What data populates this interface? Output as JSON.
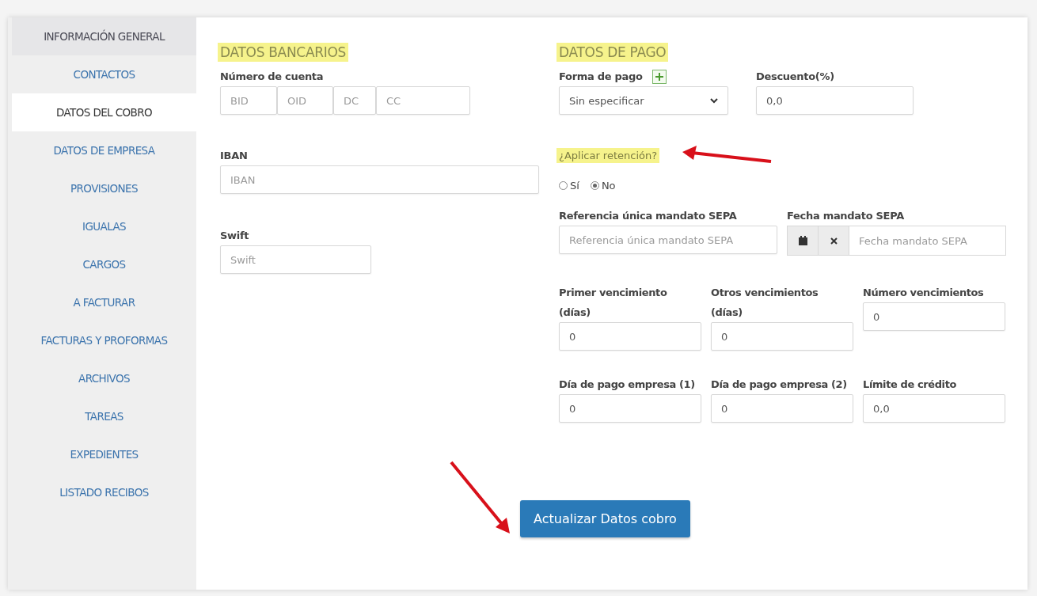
{
  "sidebar": {
    "items": [
      {
        "label": "INFORMACIÓN GENERAL",
        "selected": false
      },
      {
        "label": "CONTACTOS",
        "selected": false
      },
      {
        "label": "DATOS DEL COBRO",
        "selected": true
      },
      {
        "label": "DATOS DE EMPRESA",
        "selected": false
      },
      {
        "label": "PROVISIONES",
        "selected": false
      },
      {
        "label": "IGUALAS",
        "selected": false
      },
      {
        "label": "CARGOS",
        "selected": false
      },
      {
        "label": "A FACTURAR",
        "selected": false
      },
      {
        "label": "FACTURAS Y PROFORMAS",
        "selected": false
      },
      {
        "label": "ARCHIVOS",
        "selected": false
      },
      {
        "label": "TAREAS",
        "selected": false
      },
      {
        "label": "EXPEDIENTES",
        "selected": false
      },
      {
        "label": "LISTADO RECIBOS",
        "selected": false
      }
    ]
  },
  "bank": {
    "title": "DATOS BANCARIOS",
    "account_label": "Número de cuenta",
    "account_parts": [
      {
        "placeholder": "BID"
      },
      {
        "placeholder": "OID"
      },
      {
        "placeholder": "DC"
      },
      {
        "placeholder": "CC"
      }
    ],
    "iban_label": "IBAN",
    "iban_placeholder": "IBAN",
    "swift_label": "Swift",
    "swift_placeholder": "Swift"
  },
  "payment": {
    "title": "DATOS DE PAGO",
    "method_label": "Forma de pago",
    "method_value": "Sin especificar",
    "discount_label": "Descuento(%)",
    "discount_value": "0,0",
    "retention_label": "¿Aplicar retención?",
    "retention_options": [
      {
        "label": "Sí",
        "selected": false
      },
      {
        "label": "No",
        "selected": true
      }
    ],
    "sepa_ref_label": "Referencia única mandato SEPA",
    "sepa_ref_placeholder": "Referencia única mandato SEPA",
    "sepa_date_label": "Fecha mandato SEPA",
    "sepa_date_placeholder": "Fecha mandato SEPA",
    "fields": [
      {
        "label": "Primer vencimiento (días)",
        "value": "0"
      },
      {
        "label": "Otros vencimientos (días)",
        "value": "0"
      },
      {
        "label": "Número vencimientos",
        "value": "0"
      },
      {
        "label": "Día de pago empresa (1)",
        "value": "0"
      },
      {
        "label": "Día de pago empresa (2)",
        "value": "0"
      },
      {
        "label": "Límite de crédito",
        "value": "0,0"
      }
    ]
  },
  "submit": {
    "label": "Actualizar Datos cobro"
  }
}
